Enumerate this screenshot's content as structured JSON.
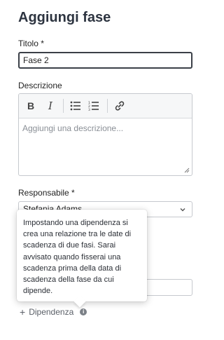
{
  "dialog": {
    "title": "Aggiungi fase"
  },
  "fields": {
    "title_label": "Titolo *",
    "title_value": "Fase 2",
    "description_label": "Descrizione",
    "description_placeholder": "Aggiungi una descrizione...",
    "assignee_label": "Responsabile *",
    "assignee_value": "Stefania Adams"
  },
  "toolbar": {
    "bold": "B",
    "italic": "I"
  },
  "dependency": {
    "link_label": "Dipendenza",
    "plus": "+",
    "info": "i",
    "tooltip": "Impostando una dipendenza si crea una relazione tra le date di scadenza di due fasi. Sarai avvisato quando fisserai una scadenza prima della data di scadenza della fase da cui dipende."
  }
}
